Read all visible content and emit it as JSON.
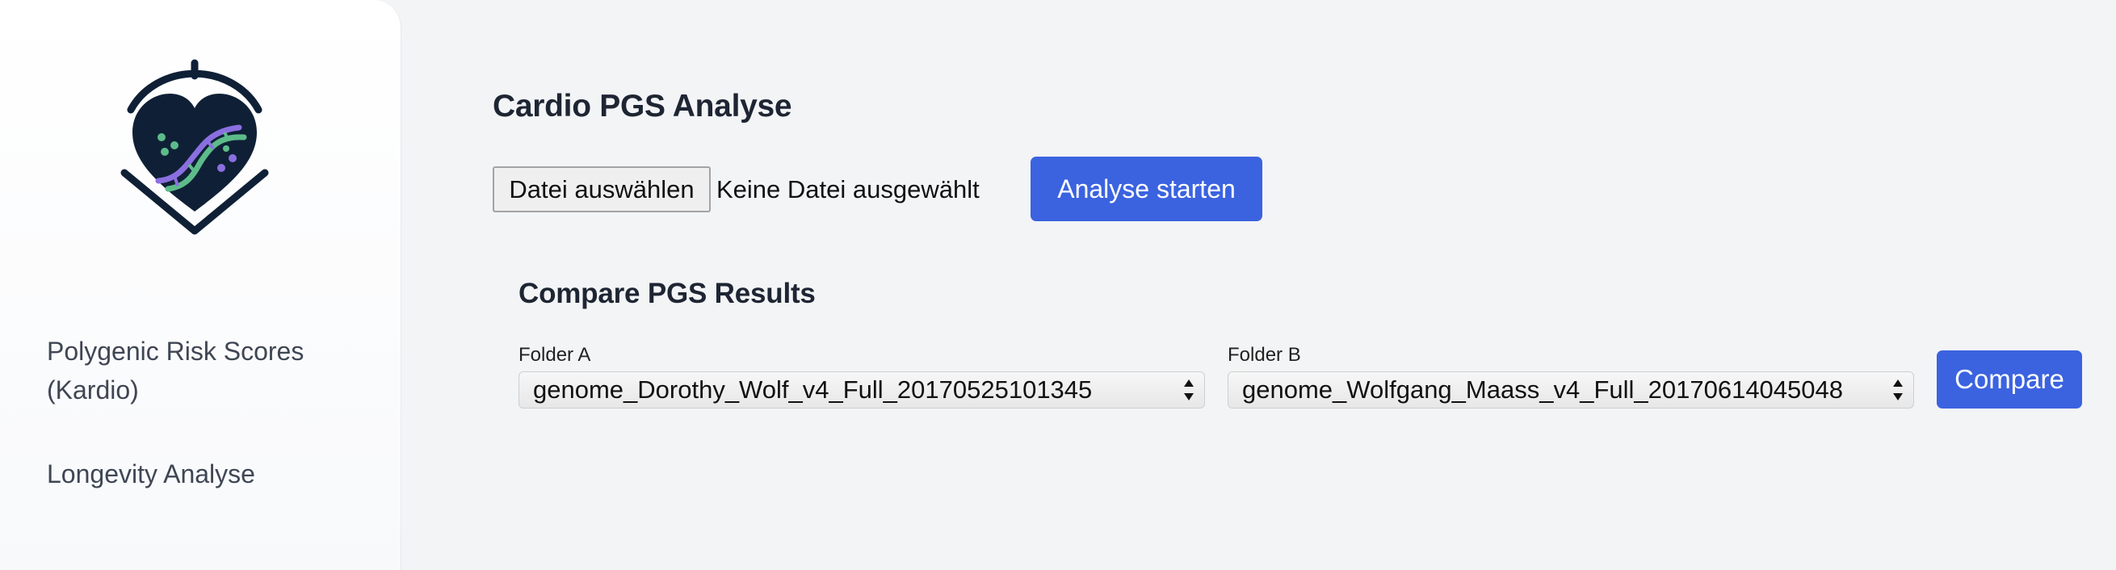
{
  "sidebar": {
    "logo_icon": "heart-dna-logo-icon",
    "items": [
      {
        "label": "Polygenic Risk Scores (Kardio)"
      },
      {
        "label": "Longevity Analyse"
      }
    ]
  },
  "main": {
    "title": "Cardio PGS Analyse",
    "file_input": {
      "button_label": "Datei auswählen",
      "status": "Keine Datei ausgewählt"
    },
    "start_button": "Analyse starten"
  },
  "compare": {
    "title": "Compare PGS Results",
    "folder_a": {
      "label": "Folder A",
      "value": "genome_Dorothy_Wolf_v4_Full_20170525101345"
    },
    "folder_b": {
      "label": "Folder B",
      "value": "genome_Wolfgang_Maass_v4_Full_20170614045048"
    },
    "button": "Compare"
  },
  "colors": {
    "accent": "#3b63e0",
    "background": "#f3f4f6",
    "sidebar": "#ffffff",
    "logo_dark": "#0f2036",
    "logo_green": "#5dbb8a",
    "logo_purple": "#8b6fe0"
  }
}
